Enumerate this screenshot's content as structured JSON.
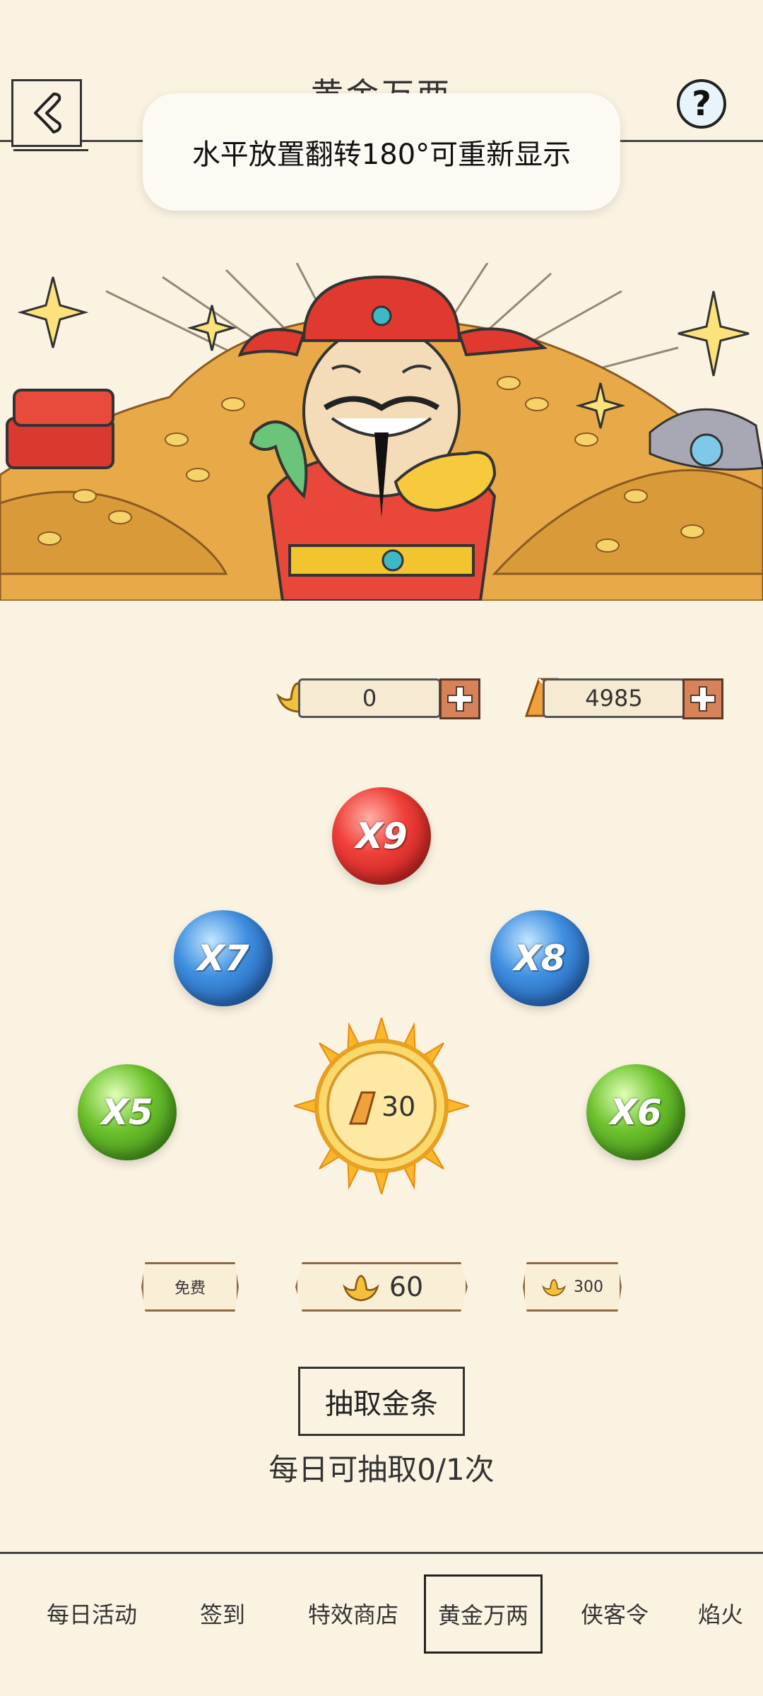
{
  "header": {
    "title": "黄金万两",
    "back_icon": "chevron-left-icon",
    "help_label": "?"
  },
  "toast": {
    "text": "水平放置翻转180°可重新显示"
  },
  "currency": {
    "ingot": {
      "value": "0",
      "icon": "gold-ingot-icon"
    },
    "gold_bar": {
      "value": "4985",
      "icon": "gold-bar-icon"
    }
  },
  "orbs": {
    "x9": "X9",
    "x7": "X7",
    "x8": "X8",
    "x5": "X5",
    "x6": "X6"
  },
  "center_coin": {
    "cost": "30"
  },
  "options": {
    "free": "免费",
    "ingot_60": "60",
    "ingot_300": "300"
  },
  "draw_button": "抽取金条",
  "daily_limit": "每日可抽取0/1次",
  "nav": {
    "items": [
      "每日活动",
      "签到",
      "特效商店",
      "黄金万两",
      "侠客令",
      "焰火"
    ],
    "active_index": 3
  },
  "colors": {
    "background": "#fbf3e2",
    "orb_red": "#e83a33",
    "orb_blue": "#3f8fe0",
    "orb_green": "#6dc22d",
    "plus_button": "#d7835a"
  }
}
